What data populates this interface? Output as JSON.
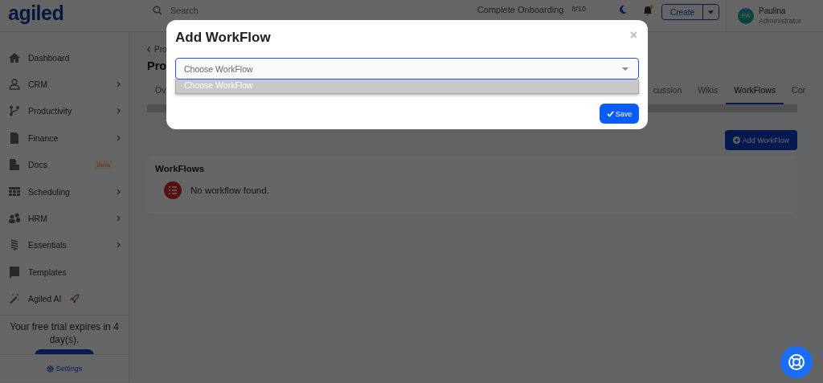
{
  "topbar": {
    "logo": "agiled",
    "search": {
      "placeholder": "Search"
    },
    "onboarding": {
      "label": "Complete Onboarding",
      "progress": "8/10"
    },
    "create_button": "Create",
    "user": {
      "initials": "PA",
      "name": "Paulina",
      "role": "Administrator"
    }
  },
  "sidebar": {
    "items": [
      {
        "label": "Dashboard",
        "kind": "home",
        "expandable": false
      },
      {
        "label": "CRM",
        "kind": "user",
        "expandable": true
      },
      {
        "label": "Productivity",
        "kind": "branch",
        "expandable": true
      },
      {
        "label": "Finance",
        "kind": "file",
        "expandable": true
      },
      {
        "label": "Docs",
        "kind": "doc",
        "expandable": false,
        "badge": "Beta"
      },
      {
        "label": "Scheduling",
        "kind": "table",
        "expandable": true
      },
      {
        "label": "HRM",
        "kind": "people",
        "expandable": true
      },
      {
        "label": "Essentials",
        "kind": "lines",
        "expandable": true
      },
      {
        "label": "Templates",
        "kind": "book",
        "expandable": false
      },
      {
        "label": "Agiled AI",
        "kind": "ai",
        "expandable": false
      }
    ],
    "trial_text": "Your free trial expires in 4 day(s).",
    "settings": "Settings"
  },
  "page": {
    "breadcrumb": "Pro",
    "title": "Pro",
    "tabs": [
      {
        "label": "Ov",
        "selected": false
      },
      {
        "label": "cussion",
        "selected": false
      },
      {
        "label": "Wikis",
        "selected": false
      },
      {
        "label": "WorkFlows",
        "selected": true
      },
      {
        "label": "Cor",
        "selected": false
      }
    ],
    "add_button": "Add WorkFlow",
    "card": {
      "title": "WorkFlows",
      "empty_text": "No workflow found."
    }
  },
  "modal": {
    "title": "Add WorkFlow",
    "close": "×",
    "select": {
      "placeholder": "Choose WorkFlow",
      "options": [
        {
          "label": "Choose WorkFlow",
          "selected": true
        }
      ]
    },
    "save_button": "Save"
  }
}
